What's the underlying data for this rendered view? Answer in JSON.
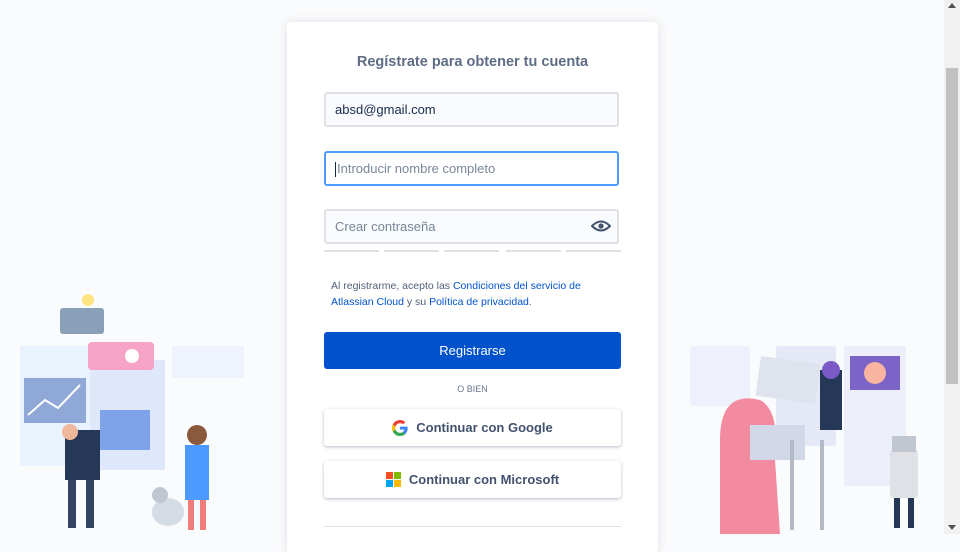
{
  "form": {
    "title": "Regístrate para obtener tu cuenta",
    "email_value": "absd@gmail.com",
    "name_placeholder": "Introducir nombre completo",
    "password_placeholder": "Crear contraseña",
    "legal_prefix": "Al registrarme, acepto las ",
    "terms_link": "Condiciones del servicio de Atlassian Cloud",
    "legal_mid": " y su ",
    "privacy_link": "Política de privacidad",
    "legal_suffix": ".",
    "submit_label": "Registrarse",
    "or_label": "O BIEN",
    "google_label": "Continuar con Google",
    "microsoft_label": "Continuar con Microsoft"
  },
  "icons": {
    "password_toggle": "eye-icon",
    "google": "google-logo-icon",
    "microsoft": "microsoft-logo-icon"
  },
  "colors": {
    "primary": "#0052cc",
    "focus_border": "#4c9aff",
    "link": "#0052cc"
  }
}
